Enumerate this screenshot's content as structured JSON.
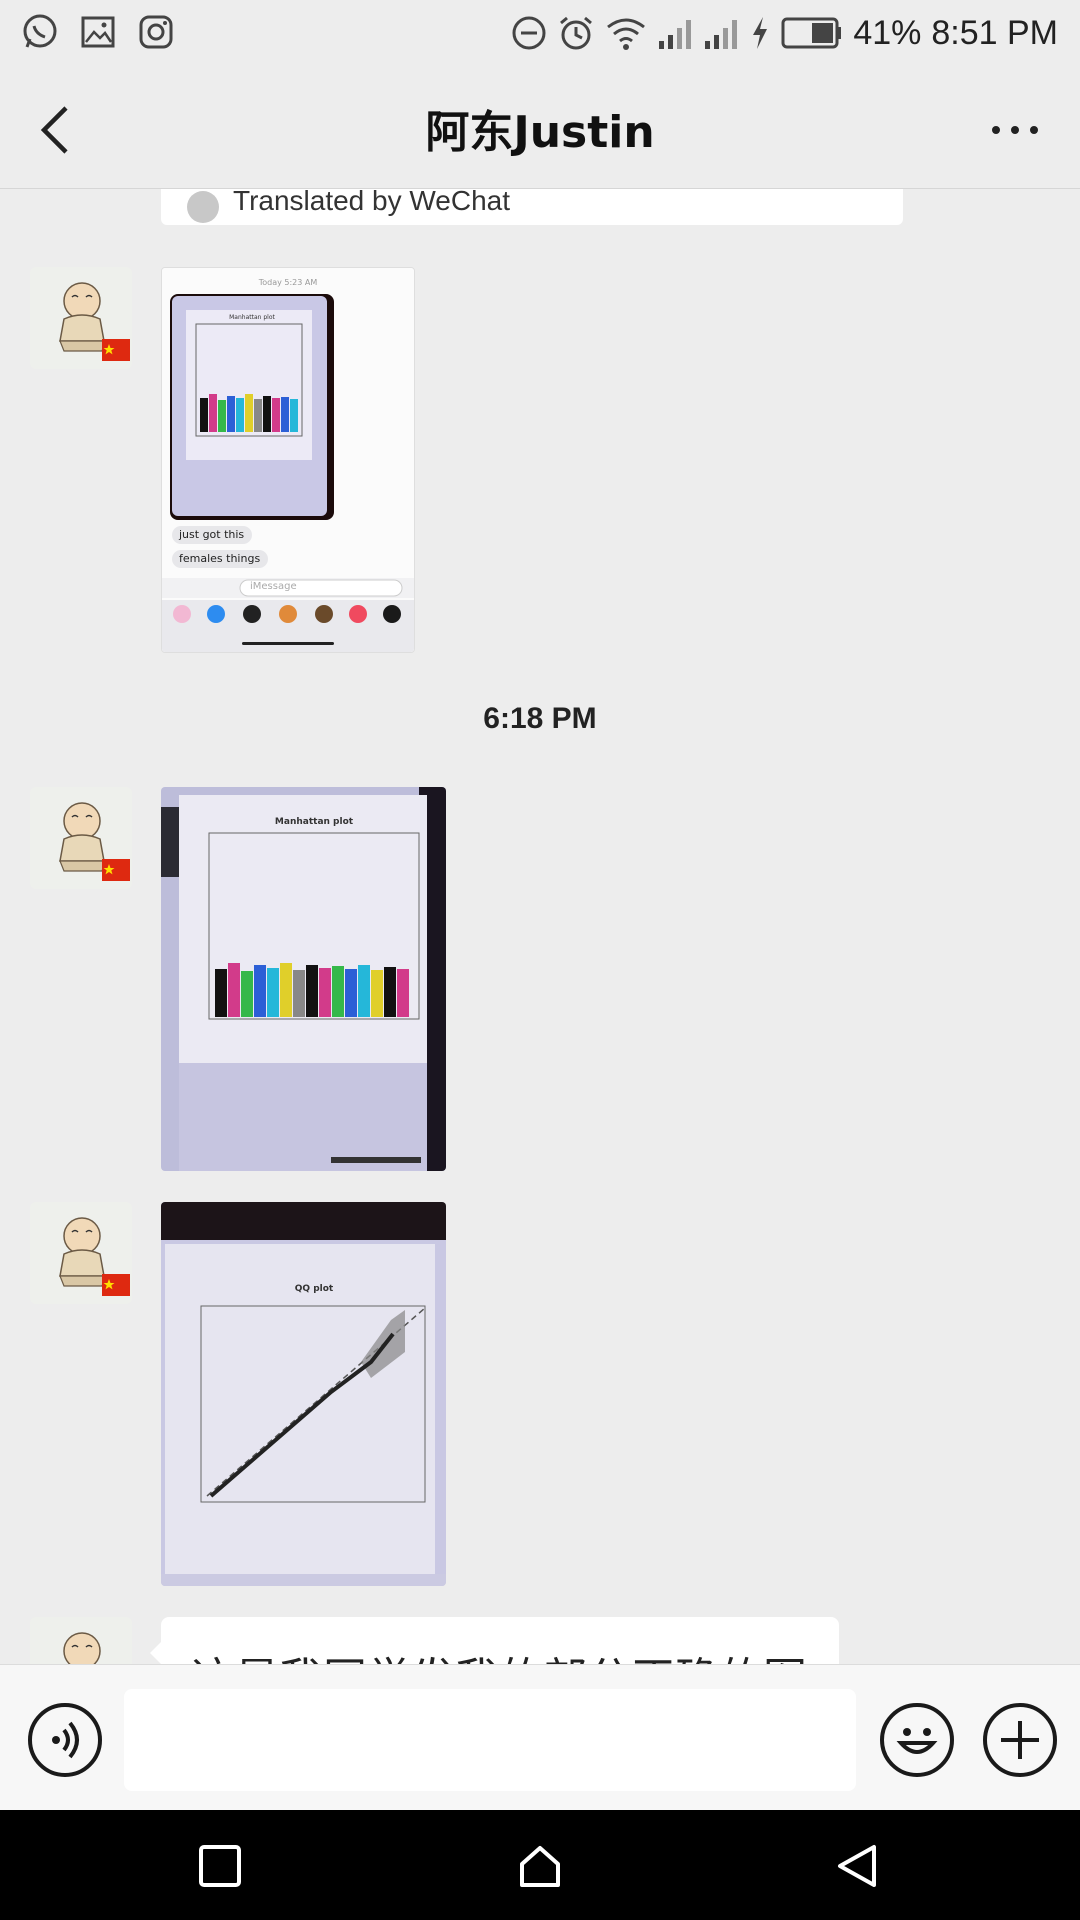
{
  "status_bar": {
    "left_icons": [
      "whatsapp-icon",
      "gallery-icon",
      "instagram-icon"
    ],
    "right_icons": [
      "dnd-icon",
      "alarm-icon",
      "wifi-icon",
      "signal-icon",
      "signal-icon",
      "charging-icon",
      "battery-icon"
    ],
    "battery": "41%",
    "time": "8:51 PM"
  },
  "header": {
    "title": "阿东Justin",
    "back_icon": "chevron-left-icon",
    "more_icon": "more-dots-icon"
  },
  "chat": {
    "translation_note": "Translated by WeChat",
    "time_separator": "6:18 PM",
    "partial_text_message": "这是我同学发我的部分正确的图",
    "image_messages": [
      {
        "kind": "phone-screenshot",
        "timestamp": "Today 5:23 AM",
        "plot_title": "Manhattan plot",
        "bubbles": [
          "just got this",
          "females things"
        ],
        "input_placeholder": "iMessage"
      },
      {
        "kind": "photo",
        "plot_title": "Manhattan plot"
      },
      {
        "kind": "photo",
        "plot_title": "QQ plot"
      }
    ]
  },
  "input_bar": {
    "voice_icon": "voice-icon",
    "emoji_icon": "emoji-icon",
    "plus_icon": "plus-icon",
    "text_value": ""
  },
  "system_nav": {
    "icons": [
      "recents-square-icon",
      "home-icon",
      "back-triangle-icon"
    ]
  },
  "colors": {
    "background": "#ededed",
    "bubble": "#ffffff",
    "nav_bar": "#000000"
  }
}
